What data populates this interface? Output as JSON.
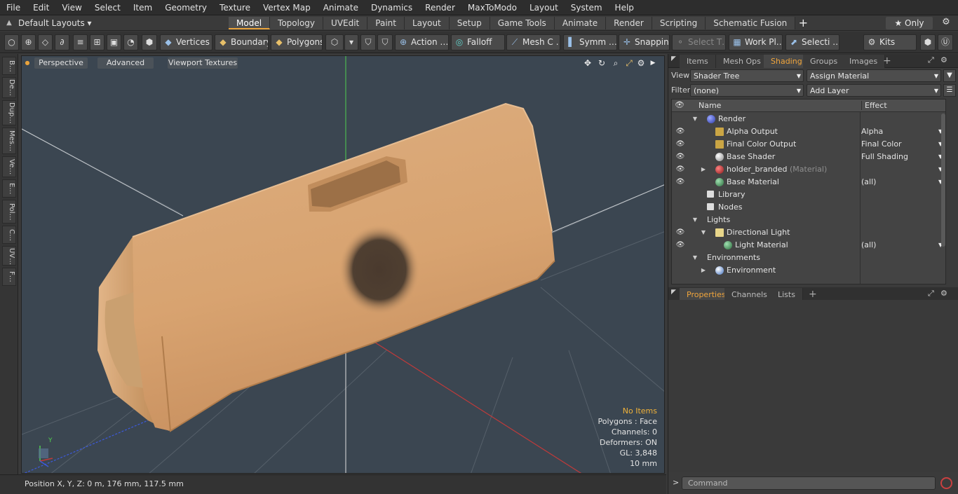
{
  "menubar": {
    "items": [
      "File",
      "Edit",
      "View",
      "Select",
      "Item",
      "Geometry",
      "Texture",
      "Vertex Map",
      "Animate",
      "Dynamics",
      "Render",
      "MaxToModo",
      "Layout",
      "System",
      "Help"
    ]
  },
  "layoutbar": {
    "layout_selector": "Default Layouts ▾",
    "tabs": [
      "Model",
      "Topology",
      "UVEdit",
      "Paint",
      "Layout",
      "Setup",
      "Game Tools",
      "Animate",
      "Render",
      "Scripting",
      "Schematic Fusion"
    ],
    "active_tab": "Model",
    "only_label": "★  Only"
  },
  "toolbar": {
    "vertices": "Vertices",
    "boundary": "Boundary",
    "polygons": "Polygons",
    "action": "Action …",
    "falloff": "Falloff",
    "mesh": "Mesh C …",
    "symm": "Symm …",
    "snapping": "Snapping",
    "select_t": "Select T…",
    "work_plane": "Work Pl…",
    "selecti": "Selecti …",
    "kits": "Kits"
  },
  "left_tabs": [
    "B…",
    "De…",
    "Dup…",
    "Mes…",
    "Ve…",
    "E…",
    "Pol…",
    "C…",
    "UV…",
    "F…"
  ],
  "viewport": {
    "view_mode": "Perspective",
    "advanced": "Advanced",
    "viewport_textures": "Viewport Textures",
    "stats": {
      "items": "No Items",
      "polygons": "Polygons : Face",
      "channels": "Channels: 0",
      "deformers": "Deformers: ON",
      "gl": "GL: 3,848",
      "grid": "10 mm"
    },
    "axis_y": "Y"
  },
  "statusbar": {
    "position": "Position X, Y, Z:   0 m, 176 mm, 117.5 mm"
  },
  "right_panel": {
    "top_tabs": [
      "Items",
      "Mesh Ops",
      "Shading",
      "Groups",
      "Images"
    ],
    "active_top_tab": "Shading",
    "view_label": "View",
    "view_value": "Shader Tree",
    "assign_material": "Assign Material",
    "filter_label": "Filter",
    "filter_value": "(none)",
    "add_layer": "Add Layer",
    "tree_header_name": "Name",
    "tree_header_effect": "Effect",
    "tree_rows": [
      {
        "name": "Render",
        "sub": "",
        "effect": ""
      },
      {
        "name": "Alpha Output",
        "sub": "",
        "effect": "Alpha"
      },
      {
        "name": "Final Color Output",
        "sub": "",
        "effect": "Final Color"
      },
      {
        "name": "Base Shader",
        "sub": "",
        "effect": "Full Shading"
      },
      {
        "name": "holder_branded",
        "sub": "(Material)",
        "effect": ""
      },
      {
        "name": "Base Material",
        "sub": "",
        "effect": "(all)"
      },
      {
        "name": "Library",
        "sub": "",
        "effect": ""
      },
      {
        "name": "Nodes",
        "sub": "",
        "effect": ""
      },
      {
        "name": "Lights",
        "sub": "",
        "effect": ""
      },
      {
        "name": "Directional Light",
        "sub": "",
        "effect": ""
      },
      {
        "name": "Light Material",
        "sub": "",
        "effect": "(all)"
      },
      {
        "name": "Environments",
        "sub": "",
        "effect": ""
      },
      {
        "name": "Environment",
        "sub": "",
        "effect": ""
      }
    ],
    "bottom_tabs": [
      "Properties",
      "Channels",
      "Lists"
    ],
    "active_bottom_tab": "Properties",
    "command_prompt": ">",
    "command_placeholder": "Command"
  },
  "colors": {
    "accent": "#e8a33c",
    "viewport_bg": "#3b4651",
    "object": "#d9a574"
  }
}
